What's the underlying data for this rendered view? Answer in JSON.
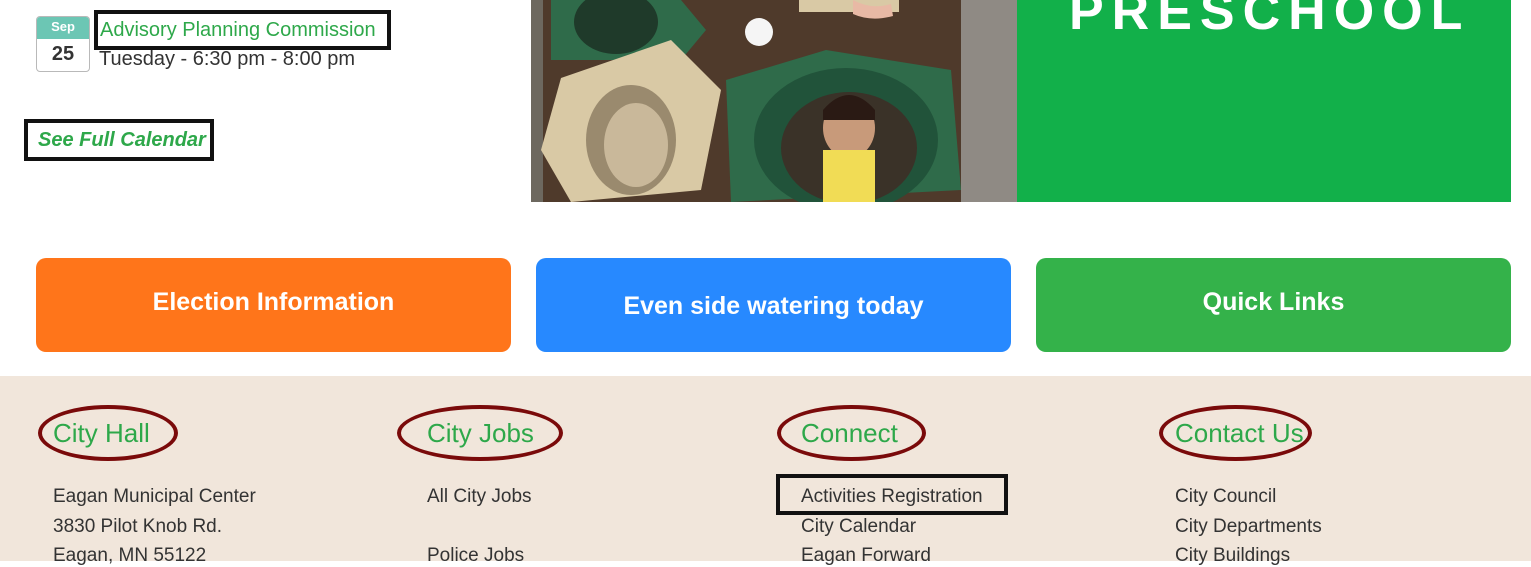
{
  "event": {
    "month": "Sep",
    "day": "25",
    "title": "Advisory Planning Commission",
    "time": "Tuesday - 6:30 pm - 8:00 pm"
  },
  "see_full_calendar": "See Full Calendar",
  "hero": {
    "text": "PRESCHOOL"
  },
  "buttons": {
    "election": "Election Information",
    "watering": "Even side watering today",
    "quick_links": "Quick Links"
  },
  "footer": {
    "city_hall": {
      "heading": "City Hall",
      "lines": [
        "Eagan Municipal Center",
        "3830 Pilot Knob Rd.",
        "Eagan, MN 55122"
      ]
    },
    "city_jobs": {
      "heading": "City Jobs",
      "links": [
        "All City Jobs",
        "Police Jobs"
      ]
    },
    "connect": {
      "heading": "Connect",
      "links": [
        "Activities Registration",
        "City Calendar",
        "Eagan Forward"
      ]
    },
    "contact": {
      "heading": "Contact Us",
      "links": [
        "City Council",
        "City Departments",
        "City Buildings"
      ]
    }
  },
  "colors": {
    "green": "#2ea84a",
    "orange": "#ff751a",
    "blue": "#2789ff",
    "footer_bg": "#f1e6db",
    "highlight_ellipse": "#7a0a0a"
  }
}
